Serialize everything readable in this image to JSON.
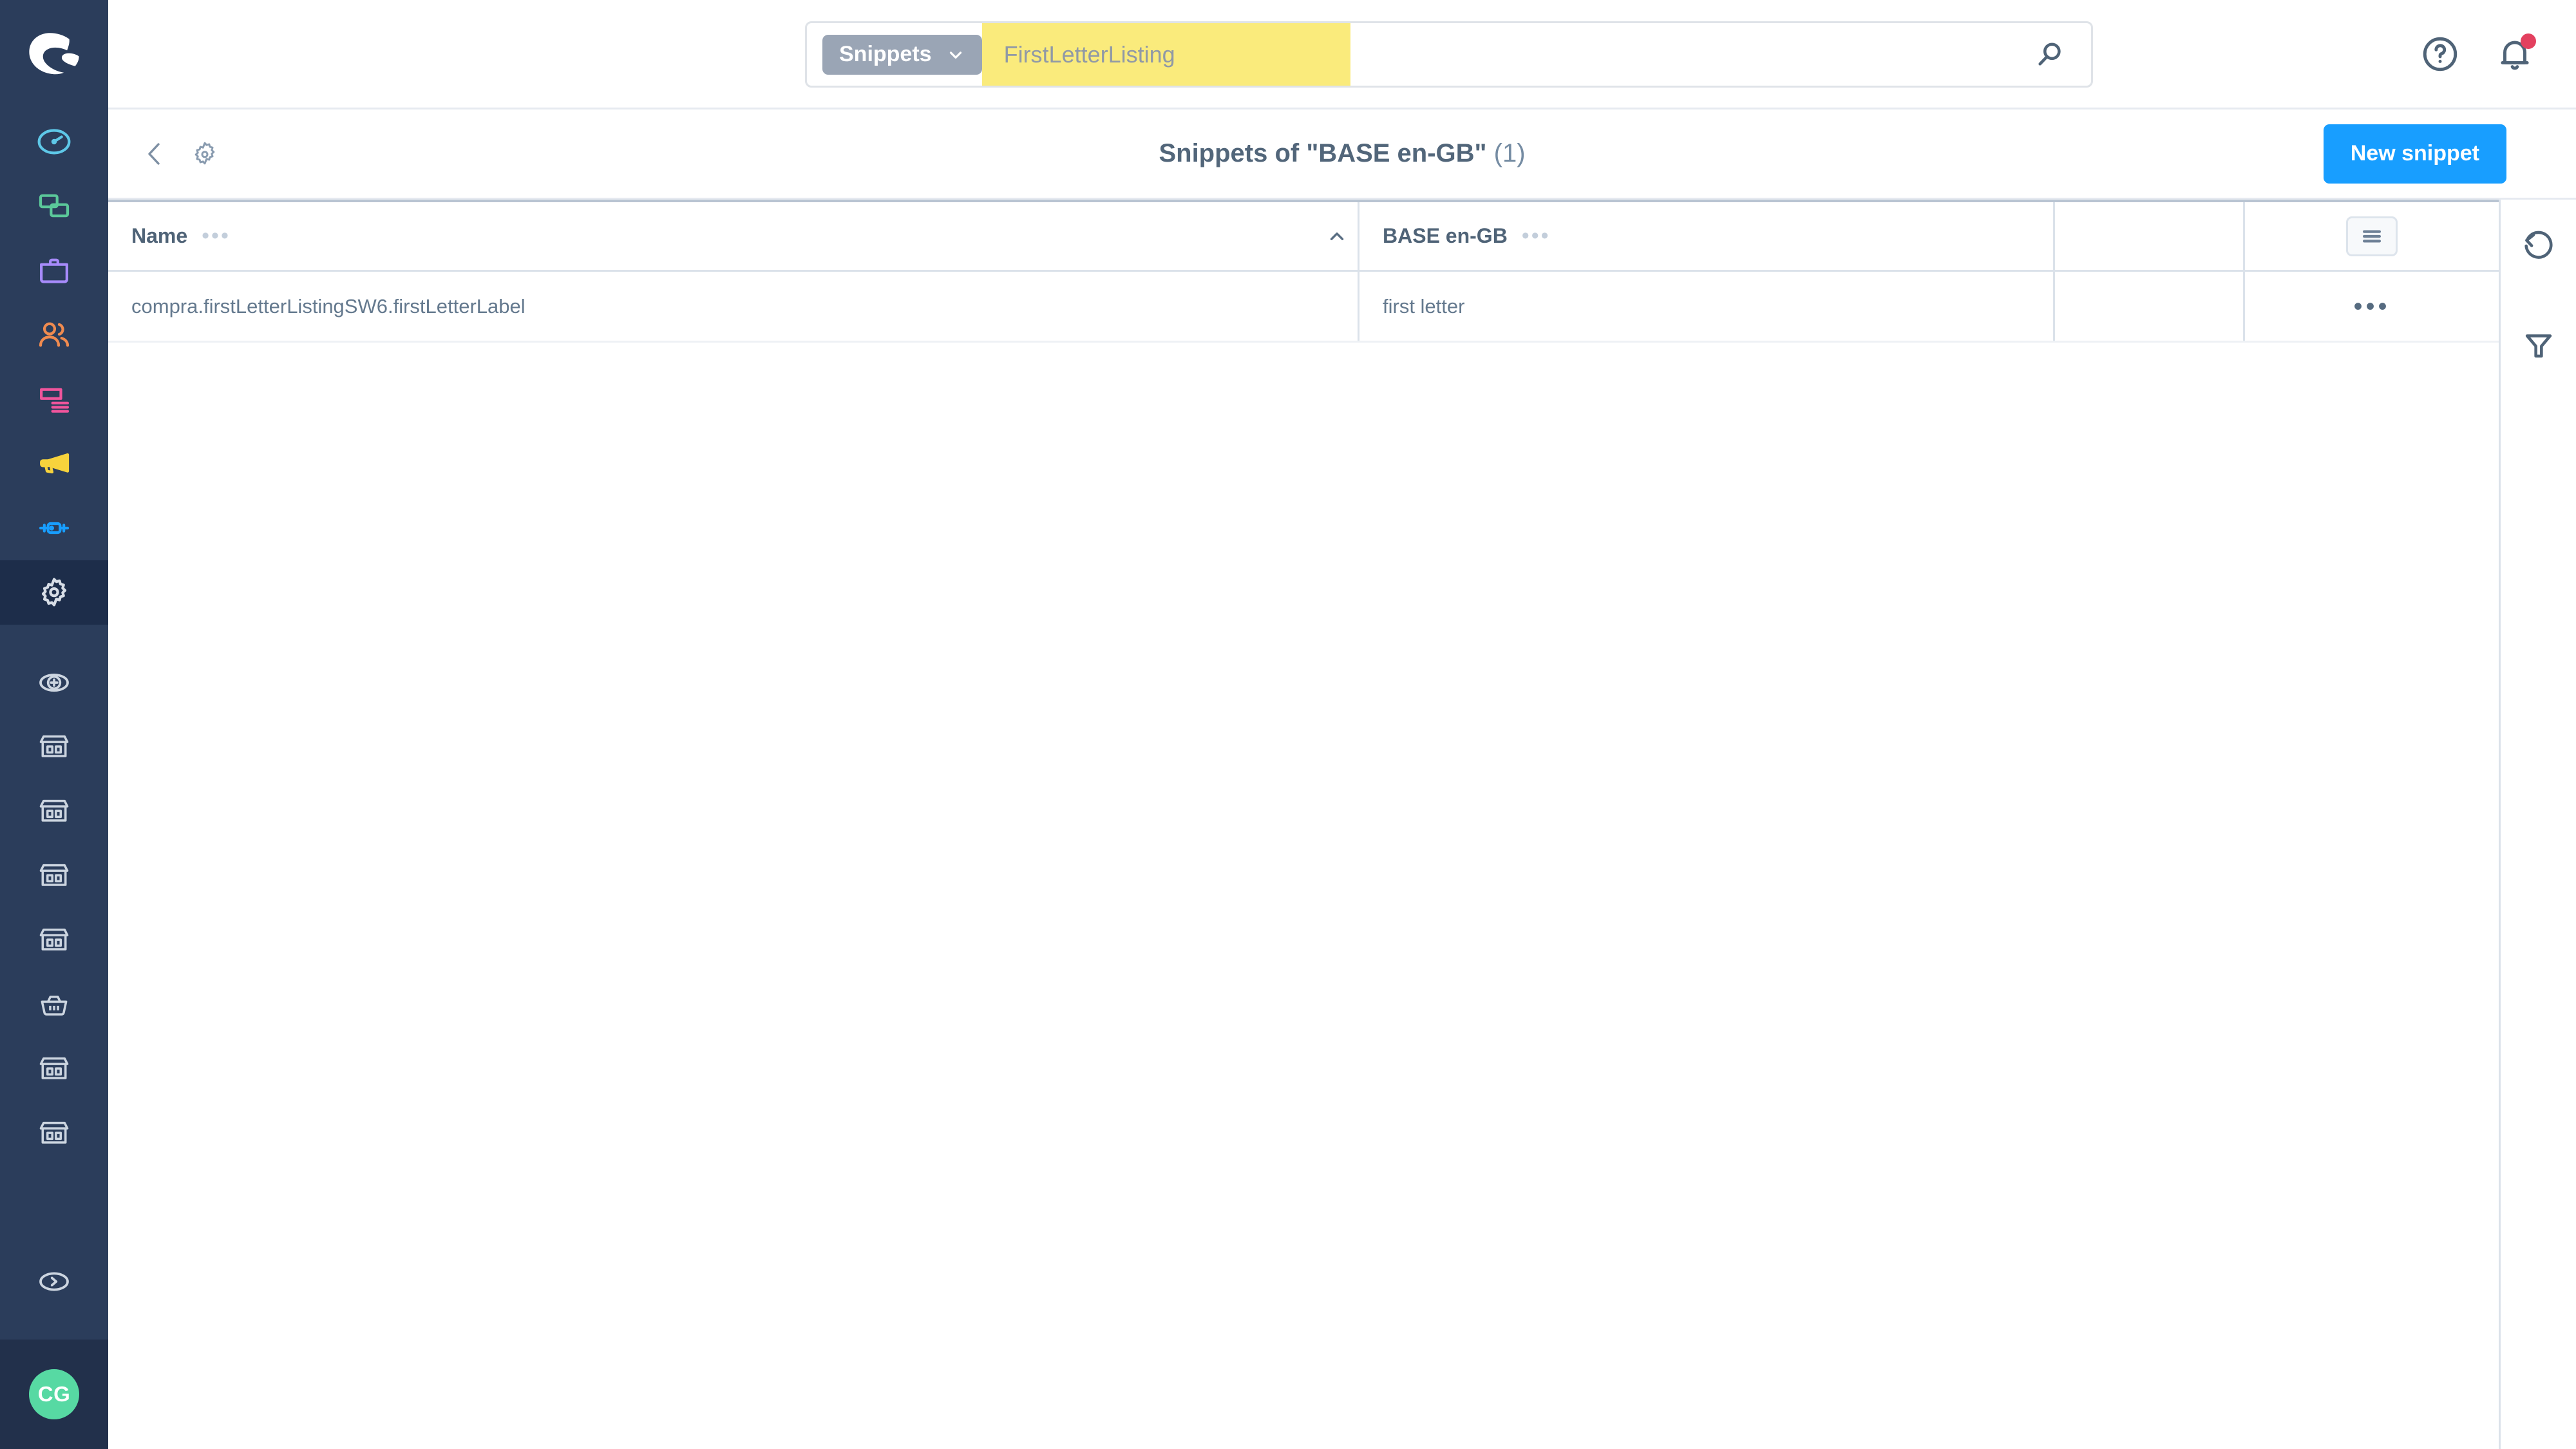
{
  "brand": {
    "logo_icon": "shopware-logo-icon",
    "accent_color": "#189eff",
    "sidebar_color": "#2b3d5b",
    "avatar_color": "#57d9a3",
    "highlight_color": "#faeb7c"
  },
  "sidebar": {
    "items": [
      {
        "icon": "dashboard-gauge-icon",
        "color": "#5ec8e8",
        "active": false
      },
      {
        "icon": "catalogues-windows-icon",
        "color": "#5bc89a",
        "active": false
      },
      {
        "icon": "orders-briefcase-icon",
        "color": "#a78bfa",
        "active": false
      },
      {
        "icon": "customers-users-icon",
        "color": "#f08b4f",
        "active": false
      },
      {
        "icon": "content-layout-icon",
        "color": "#f0559c",
        "active": false
      },
      {
        "icon": "marketing-megaphone-icon",
        "color": "#f7d33c",
        "active": false
      },
      {
        "icon": "extensions-plug-icon",
        "color": "#189eff",
        "active": false
      },
      {
        "icon": "settings-gear-icon",
        "color": "#d7dde6",
        "active": true
      }
    ],
    "shop_items": [
      {
        "icon": "add-circle-icon"
      },
      {
        "icon": "storefront-icon"
      },
      {
        "icon": "storefront-icon"
      },
      {
        "icon": "storefront-icon"
      },
      {
        "icon": "storefront-icon"
      },
      {
        "icon": "basket-icon"
      },
      {
        "icon": "storefront-icon"
      },
      {
        "icon": "storefront-icon"
      }
    ],
    "expand": {
      "icon": "chevron-right-circle-icon"
    },
    "avatar": {
      "initials": "CG"
    }
  },
  "topbar": {
    "search": {
      "type_label": "Snippets",
      "type_chevron_icon": "chevron-down-icon",
      "value": "FirstLetterListing",
      "placeholder": "FirstLetterListing",
      "search_icon": "search-icon"
    },
    "help": {
      "icon": "help-circle-icon"
    },
    "notifications": {
      "icon": "bell-icon",
      "has_unread": true
    }
  },
  "page_header": {
    "back": {
      "icon": "chevron-left-icon"
    },
    "settings": {
      "icon": "gear-icon"
    },
    "title_main": "Snippets of \"BASE en-GB\"",
    "title_count": "(1)",
    "primary_button": "New snippet"
  },
  "table": {
    "columns": [
      {
        "label": "Name",
        "menu_icon": "ellipsis-icon",
        "sorted": true,
        "sort_direction": "asc",
        "sort_icon": "caret-up-icon"
      },
      {
        "label": "BASE en-GB",
        "menu_icon": "ellipsis-icon",
        "sorted": false
      }
    ],
    "list_toggle": {
      "icon": "list-view-icon"
    },
    "rows": [
      {
        "name": "compra.firstLetterListingSW6.firstLetterLabel",
        "base_en_gb": "first letter",
        "row_menu_icon": "ellipsis-icon"
      }
    ]
  },
  "right_rail": {
    "buttons": [
      {
        "icon": "reset-undo-icon"
      },
      {
        "icon": "filter-funnel-icon"
      }
    ]
  }
}
